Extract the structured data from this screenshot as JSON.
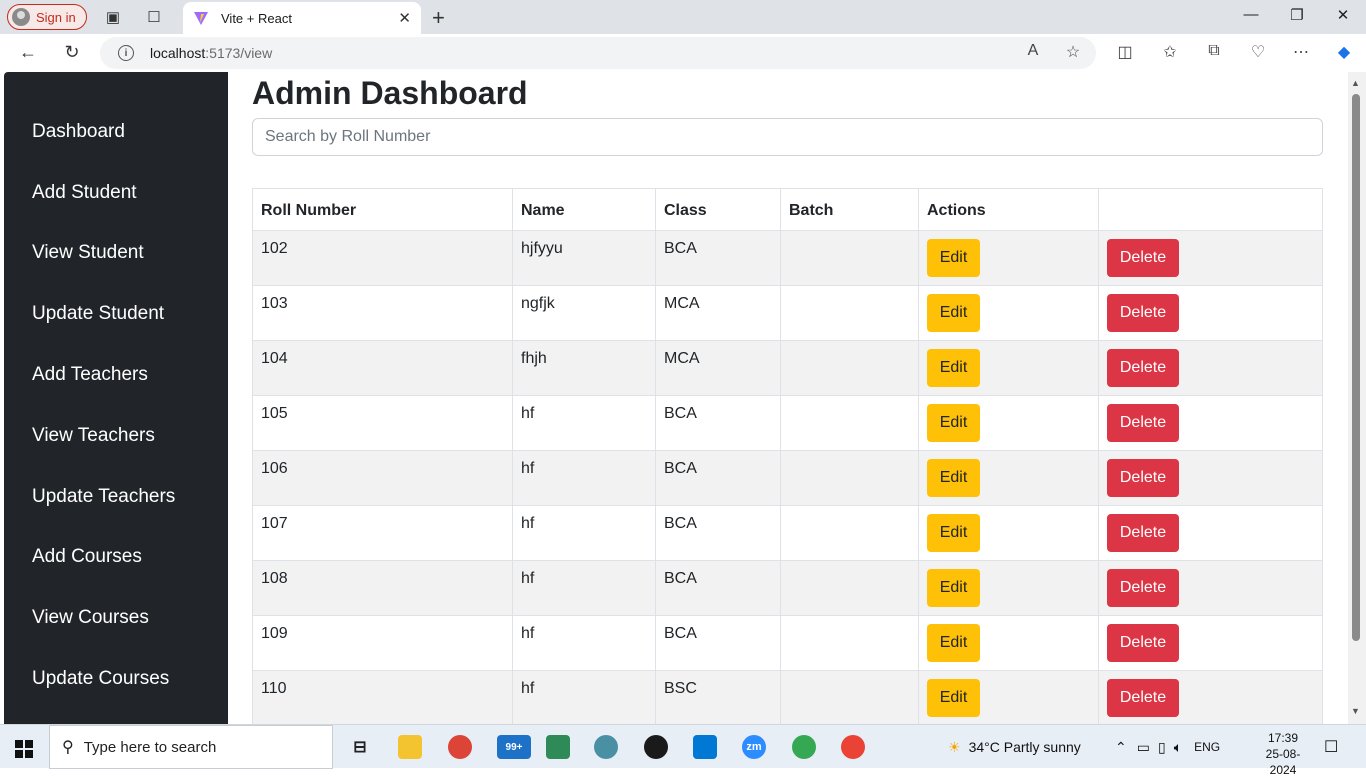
{
  "browser": {
    "sign_in": "Sign in",
    "tab_title": "Vite + React",
    "url_host": "localhost",
    "url_path": ":5173/view"
  },
  "sidebar": {
    "items": [
      {
        "label": "Dashboard"
      },
      {
        "label": "Add Student"
      },
      {
        "label": "View Student"
      },
      {
        "label": "Update Student"
      },
      {
        "label": "Add Teachers"
      },
      {
        "label": "View Teachers"
      },
      {
        "label": "Update Teachers"
      },
      {
        "label": "Add Courses"
      },
      {
        "label": "View Courses"
      },
      {
        "label": "Update Courses"
      }
    ]
  },
  "main": {
    "title": "Admin Dashboard",
    "search_placeholder": "Search by Roll Number",
    "columns": [
      "Roll Number",
      "Name",
      "Class",
      "Batch",
      "Actions",
      ""
    ],
    "edit_label": "Edit",
    "delete_label": "Delete",
    "rows": [
      {
        "roll": "102",
        "name": "hjfyyu",
        "class": "BCA",
        "batch": ""
      },
      {
        "roll": "103",
        "name": "ngfjk",
        "class": "MCA",
        "batch": ""
      },
      {
        "roll": "104",
        "name": "fhjh",
        "class": "MCA",
        "batch": ""
      },
      {
        "roll": "105",
        "name": "hf",
        "class": "BCA",
        "batch": ""
      },
      {
        "roll": "106",
        "name": "hf",
        "class": "BCA",
        "batch": ""
      },
      {
        "roll": "107",
        "name": "hf",
        "class": "BCA",
        "batch": ""
      },
      {
        "roll": "108",
        "name": "hf",
        "class": "BCA",
        "batch": ""
      },
      {
        "roll": "109",
        "name": "hf",
        "class": "BCA",
        "batch": ""
      },
      {
        "roll": "110",
        "name": "hf",
        "class": "BSC",
        "batch": ""
      }
    ]
  },
  "taskbar": {
    "search_placeholder": "Type here to search",
    "mail_badge": "99+",
    "weather": "34°C  Partly sunny",
    "language": "ENG",
    "time": "17:39",
    "date": "25-08-2024"
  },
  "colors": {
    "sidebar_bg": "#212529",
    "edit_button": "#ffc107",
    "delete_button": "#dc3545"
  }
}
